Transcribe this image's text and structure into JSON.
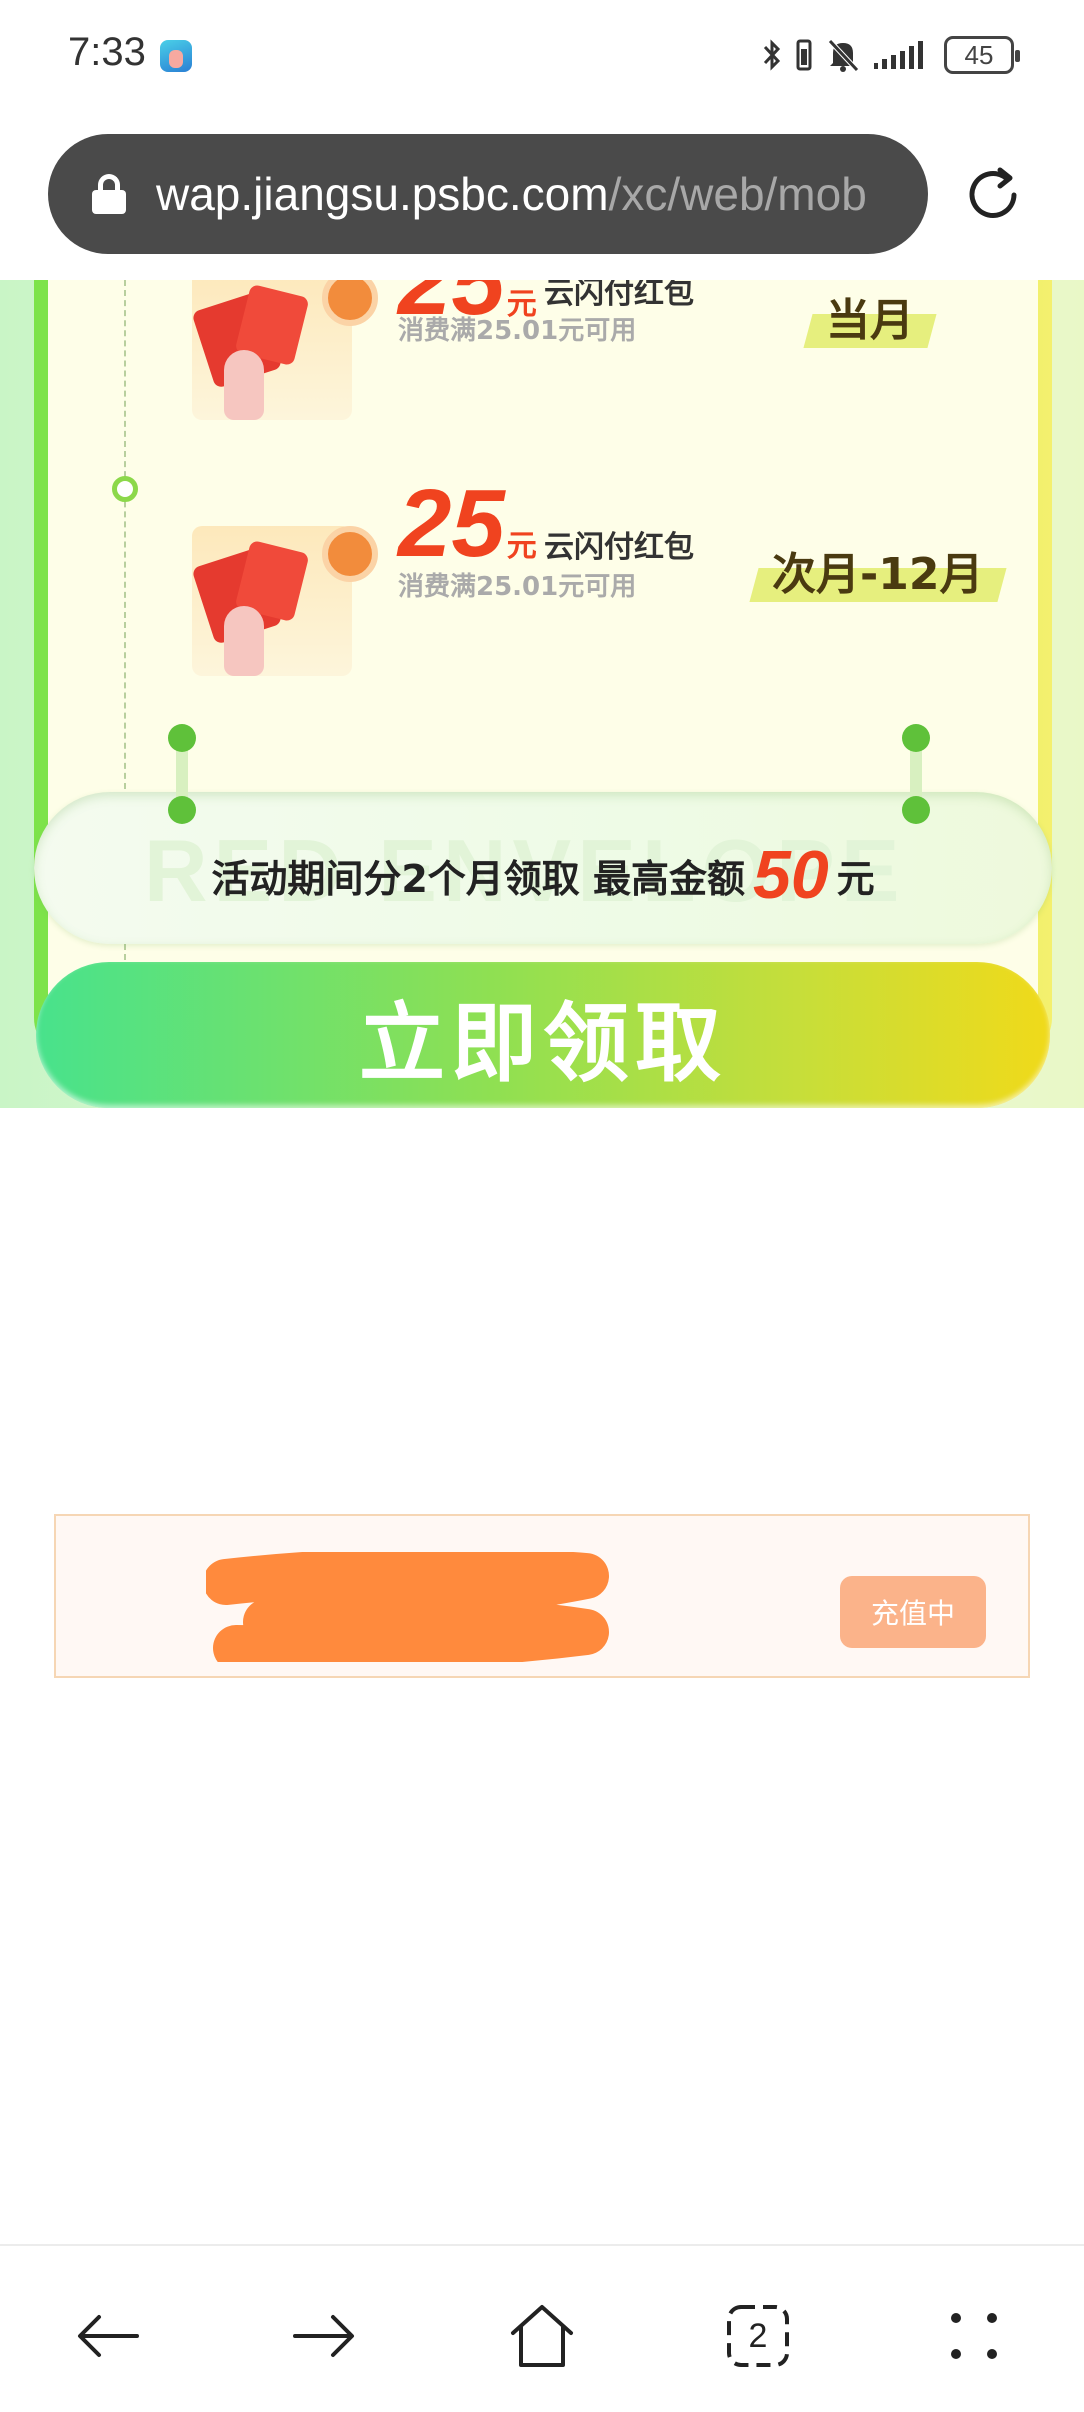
{
  "status_bar": {
    "time": "7:33",
    "battery": "45",
    "icons": [
      "app-notification-icon",
      "bluetooth-icon",
      "vibrate-icon",
      "mute-icon",
      "signal-icon",
      "battery-icon"
    ]
  },
  "url_bar": {
    "host": "wap.jiangsu.psbc.com",
    "path": "/xc/web/mob",
    "reload_icon": "reload-icon"
  },
  "offers": [
    {
      "amount": "25",
      "unit": "元",
      "type": "云闪付红包",
      "condition": "消费满25.01元可用",
      "period": "当月"
    },
    {
      "amount": "25",
      "unit": "元",
      "type": "云闪付红包",
      "condition": "消费满25.01元可用",
      "period": "次月-12月"
    }
  ],
  "summary": {
    "watermark": "RED ENVELOPE",
    "prefix": "活动期间分2个月领取  最高金额",
    "amount": "50",
    "suffix": "元"
  },
  "claim_button": "立即领取",
  "recharge": {
    "button": "充值中"
  },
  "colors": {
    "accent_green": "#7de34a",
    "amount_red": "#f0431f",
    "button_gradient_start": "#48e28c",
    "button_gradient_end": "#f0da1a",
    "recharge_button": "#fbb38a",
    "redaction": "#ff8a3d"
  },
  "bottom_nav": {
    "tab_count": "2",
    "icons": [
      "back-arrow-icon",
      "forward-arrow-icon",
      "home-icon",
      "tabs-icon",
      "menu-dots-icon"
    ]
  }
}
